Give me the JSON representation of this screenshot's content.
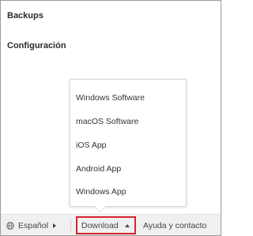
{
  "nav": {
    "items": [
      {
        "label": "Backups"
      },
      {
        "label": "Configuración"
      }
    ]
  },
  "dropdown": {
    "items": [
      {
        "label": "Windows Software"
      },
      {
        "label": "macOS Software"
      },
      {
        "label": "iOS App"
      },
      {
        "label": "Android App"
      },
      {
        "label": "Windows App"
      }
    ]
  },
  "footer": {
    "language": {
      "label": "Español",
      "icon": "globe-icon"
    },
    "download": {
      "label": "Download",
      "icon": "caret-up-icon",
      "highlight_color": "#d6242e"
    },
    "help": {
      "label": "Ayuda y contacto"
    }
  }
}
